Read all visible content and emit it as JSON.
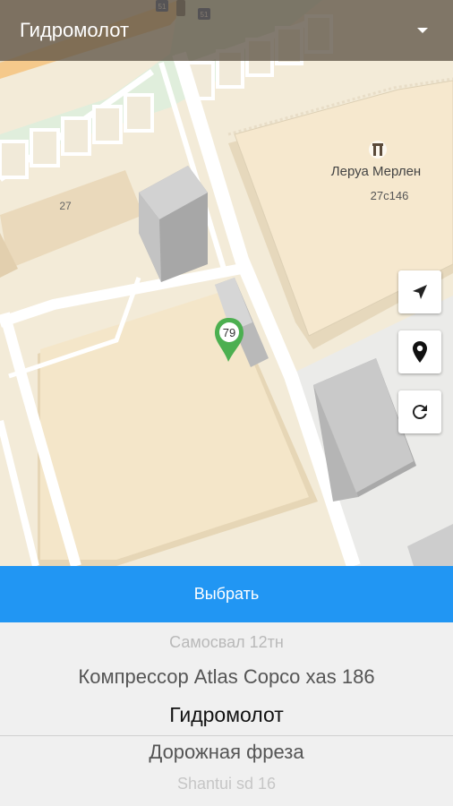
{
  "header": {
    "title": "Гидромолот",
    "dropdown_icon": "chevron-down-icon"
  },
  "map": {
    "poi_name": "Леруа Мерлен",
    "poi_house_number": "27с146",
    "house_number_27": "27",
    "marker_label": "79",
    "bus_stop_1": "51",
    "bus_stop_2": "51",
    "marker_color": "#4caf50"
  },
  "map_controls": {
    "locate_icon": "navigation-arrow-icon",
    "pin_icon": "map-pin-icon",
    "refresh_icon": "refresh-icon"
  },
  "select_button": {
    "label": "Выбрать",
    "color": "#2196f3"
  },
  "picker": {
    "items": [
      "Самосвал 12тн",
      "Компрессор Atlas Copco xas 186",
      "Гидромолот",
      "Дорожная фреза",
      "Shantui sd 16"
    ],
    "selected": "Гидромолот"
  }
}
